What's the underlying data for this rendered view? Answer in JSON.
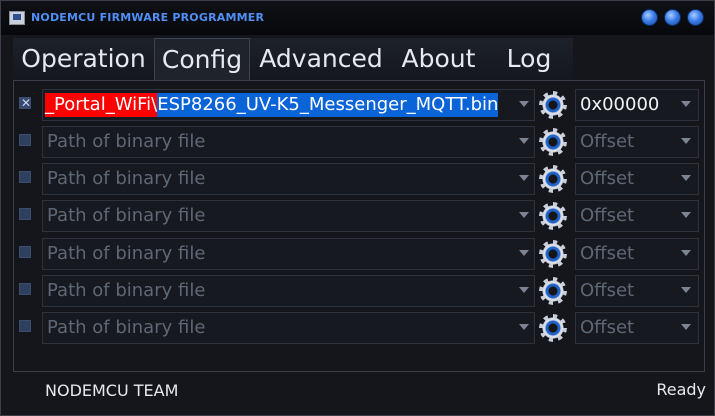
{
  "window": {
    "title": "NODEMCU FIRMWARE PROGRAMMER"
  },
  "tabs": [
    {
      "label": "Operation",
      "active": false
    },
    {
      "label": "Config",
      "active": true
    },
    {
      "label": "Advanced",
      "active": false
    },
    {
      "label": "About",
      "active": false
    },
    {
      "label": "Log",
      "active": false
    }
  ],
  "rows": [
    {
      "checked": true,
      "path_selected_part1": "_Portal_WiFi\\",
      "path_selected_part2": "ESP8266_UV-K5_Messenger_MQTT.bin",
      "path_placeholder": "",
      "offset_value": "0x00000",
      "offset_placeholder": ""
    },
    {
      "checked": false,
      "path_placeholder": "Path of binary file",
      "offset_placeholder": "Offset"
    },
    {
      "checked": false,
      "path_placeholder": "Path of binary file",
      "offset_placeholder": "Offset"
    },
    {
      "checked": false,
      "path_placeholder": "Path of binary file",
      "offset_placeholder": "Offset"
    },
    {
      "checked": false,
      "path_placeholder": "Path of binary file",
      "offset_placeholder": "Offset"
    },
    {
      "checked": false,
      "path_placeholder": "Path of binary file",
      "offset_placeholder": "Offset"
    },
    {
      "checked": false,
      "path_placeholder": "Path of binary file",
      "offset_placeholder": "Offset"
    }
  ],
  "status": {
    "left": "NODEMCU TEAM",
    "right": "Ready"
  },
  "icons": {
    "window_buttons": [
      "minimize-icon",
      "maximize-icon",
      "close-icon"
    ],
    "row_action": "gear-icon"
  },
  "colors": {
    "title": "#4f8ff7",
    "selection_red": "#ff0000",
    "selection_blue": "#0a64d8",
    "background": "#14161b"
  }
}
